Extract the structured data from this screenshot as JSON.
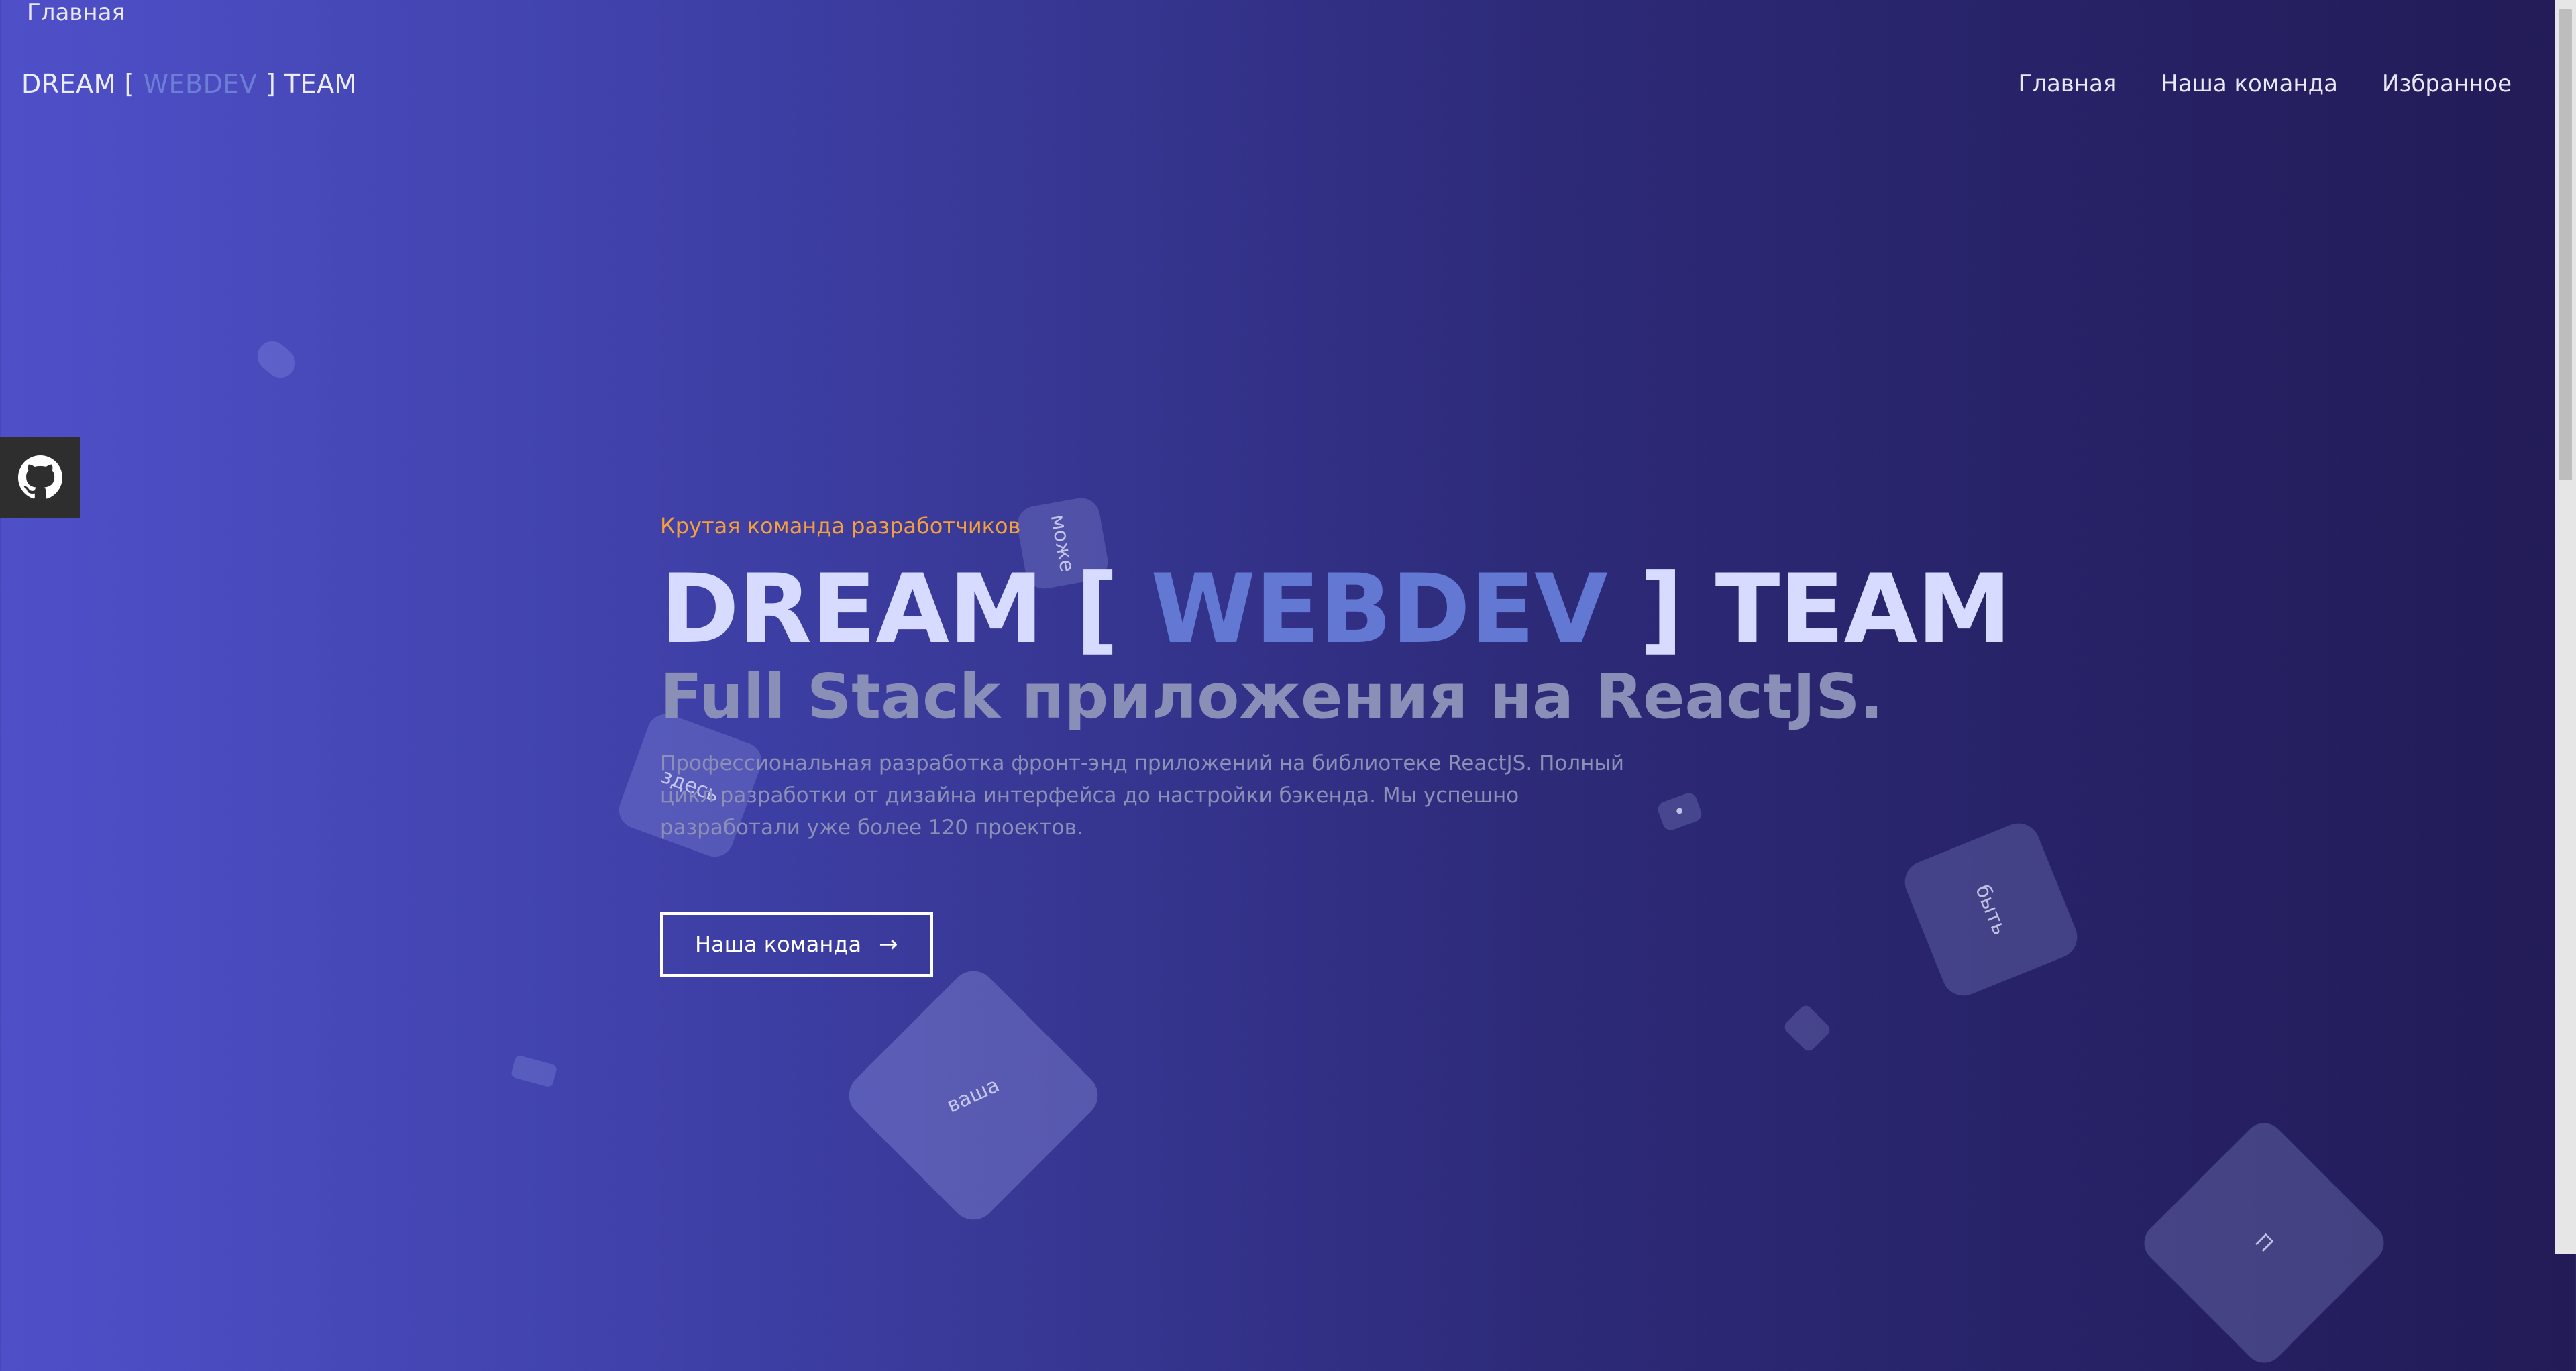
{
  "top_label": "Главная",
  "navbar": {
    "brand_prefix": "DREAM [ ",
    "brand_accent": "WEBDEV",
    "brand_suffix": " ] TEAM",
    "links": [
      "Главная",
      "Наша команда",
      "Избранное"
    ]
  },
  "hero": {
    "kicker": "Крутая команда разработчиков",
    "title_prefix": "DREAM [ ",
    "title_accent": "WEBDEV",
    "title_suffix": " ] TEAM",
    "subtitle": "Full Stack приложения на ReactJS.",
    "description": "Профессиональная разработка фронт-энд приложений на библиотеке ReactJS. Полный цикл разработки от дизайна интерфейса до настройки бэкенда. Мы успешно разработали уже более 120 проектов.",
    "cta_label": "Наша команда",
    "cta_arrow": "→"
  },
  "floating_words": [
    "може",
    "здесь",
    "быть",
    "ваша",
    "•",
    "П"
  ],
  "icons": {
    "github": "github-icon"
  },
  "colors": {
    "accent": "#6378d2",
    "kicker": "#f5a03a",
    "title": "#d6dbff",
    "subtitle": "#8a8fb8"
  }
}
